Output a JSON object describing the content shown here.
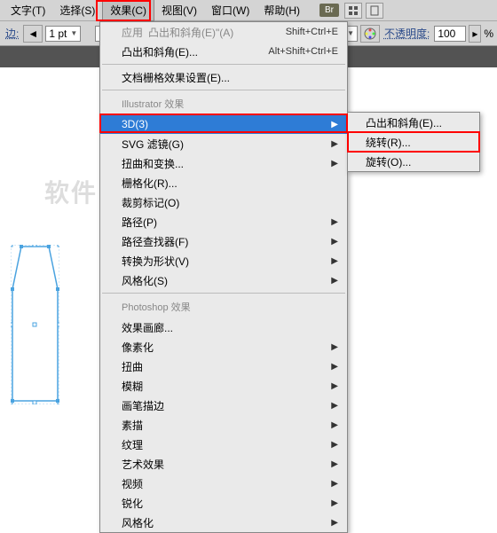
{
  "menubar": {
    "items": [
      "文字(T)",
      "选择(S)",
      "效果(C)",
      "视图(V)",
      "窗口(W)",
      "帮助(H)"
    ],
    "badge": "Br"
  },
  "toolbar": {
    "stroke_prefix": "边:",
    "stroke_value": "1 pt",
    "opacity_label": "不透明度:",
    "opacity_value": "100",
    "opacity_suffix": "%"
  },
  "dropdown": {
    "apply": "应用",
    "apply_shortcut": "Shift+Ctrl+E",
    "bevel1": "凸出和斜角(E)\"(A)",
    "bevel2": "凸出和斜角(E)...",
    "bevel2_shortcut": "Alt+Shift+Ctrl+E",
    "raster": "文档栅格效果设置(E)...",
    "section_ai": "Illustrator 效果",
    "three_d": "3D(3)",
    "svg": "SVG 滤镜(G)",
    "convert": "扭曲和变换...",
    "rasterize": "栅格化(R)...",
    "crop": "裁剪标记(O)",
    "path": "路径(P)",
    "pathfinder": "路径查找器(F)",
    "convert_shape": "转换为形状(V)",
    "stylize": "风格化(S)",
    "section_ps": "Photoshop 效果",
    "gallery": "效果画廊...",
    "pixelate": "像素化",
    "distort": "扭曲",
    "blur": "模糊",
    "brush": "画笔描边",
    "sketch": "素描",
    "texture": "纹理",
    "artistic": "艺术效果",
    "video": "视频",
    "sharpen": "锐化",
    "stylize2": "风格化"
  },
  "submenu": {
    "extrude": "凸出和斜角(E)...",
    "revolve": "绕转(R)...",
    "rotate": "旋转(O)..."
  },
  "watermark": "软件自学网"
}
